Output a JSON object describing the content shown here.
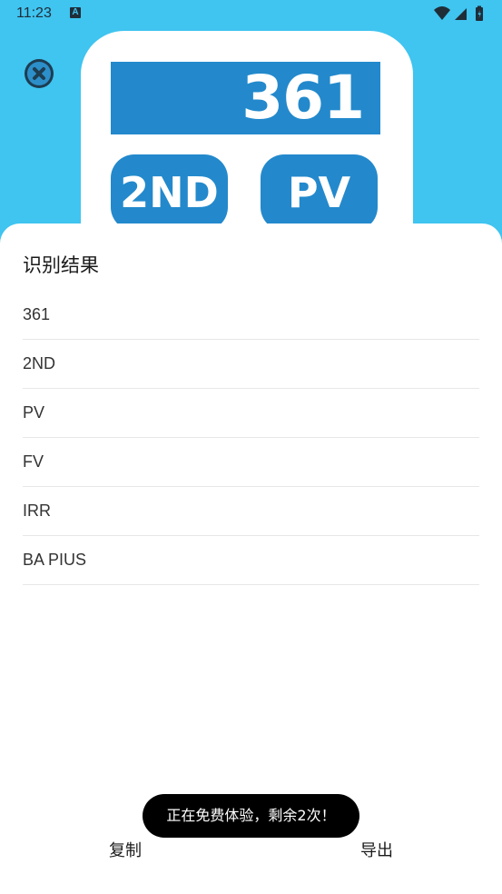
{
  "status_bar": {
    "time": "11:23",
    "notification_icon": "A",
    "icons": [
      "wifi-icon",
      "signal-icon",
      "battery-icon"
    ]
  },
  "close_button": {
    "icon": "close-icon"
  },
  "calculator_image": {
    "display_value": "361",
    "keys": [
      "2ND",
      "PV"
    ],
    "colors": {
      "body": "#ffffff",
      "keys": "#2389cc",
      "background": "#40c4f0"
    }
  },
  "sheet": {
    "title": "识别结果",
    "results": [
      "361",
      "2ND",
      "PV",
      "FV",
      "IRR",
      "BA PIUS"
    ]
  },
  "toast": {
    "text": "正在免费体验，剩余2次！"
  },
  "actions": {
    "copy_label": "复制",
    "export_label": "导出"
  }
}
